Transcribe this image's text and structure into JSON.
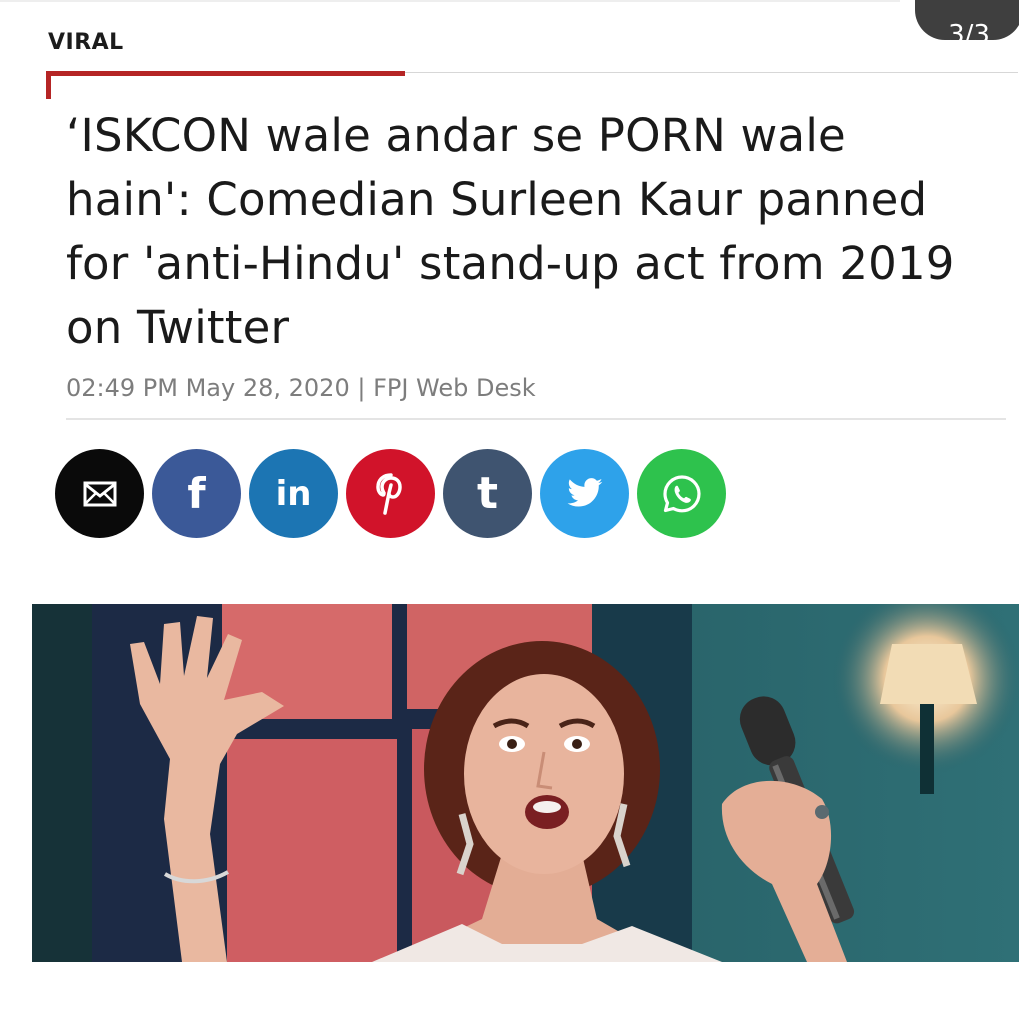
{
  "pagination": {
    "indicator": "3/3"
  },
  "article": {
    "category": "VIRAL",
    "headline": "‘ISKCON wale andar se PORN wale hain': Comedian Surleen Kaur panned for 'anti-Hindu' stand-up act from 2019 on Twitter",
    "meta": "02:49 PM May 28, 2020 | FPJ Web Desk"
  },
  "share": [
    {
      "network": "email",
      "icon": "envelope-icon",
      "color": "#0a0a0a"
    },
    {
      "network": "facebook",
      "icon": "facebook-icon",
      "glyph": "f",
      "color": "#3b5998"
    },
    {
      "network": "linkedin",
      "icon": "linkedin-icon",
      "glyph": "in",
      "color": "#1c75b3"
    },
    {
      "network": "pinterest",
      "icon": "pinterest-icon",
      "glyph": "p",
      "color": "#d1132a"
    },
    {
      "network": "tumblr",
      "icon": "tumblr-icon",
      "glyph": "t",
      "color": "#3f5470"
    },
    {
      "network": "twitter",
      "icon": "twitter-bird-icon",
      "color": "#2ea2ea"
    },
    {
      "network": "whatsapp",
      "icon": "whatsapp-icon",
      "color": "#2ec24d"
    }
  ],
  "hero_image": {
    "subject": "woman holding microphone on stage with raised hand"
  }
}
